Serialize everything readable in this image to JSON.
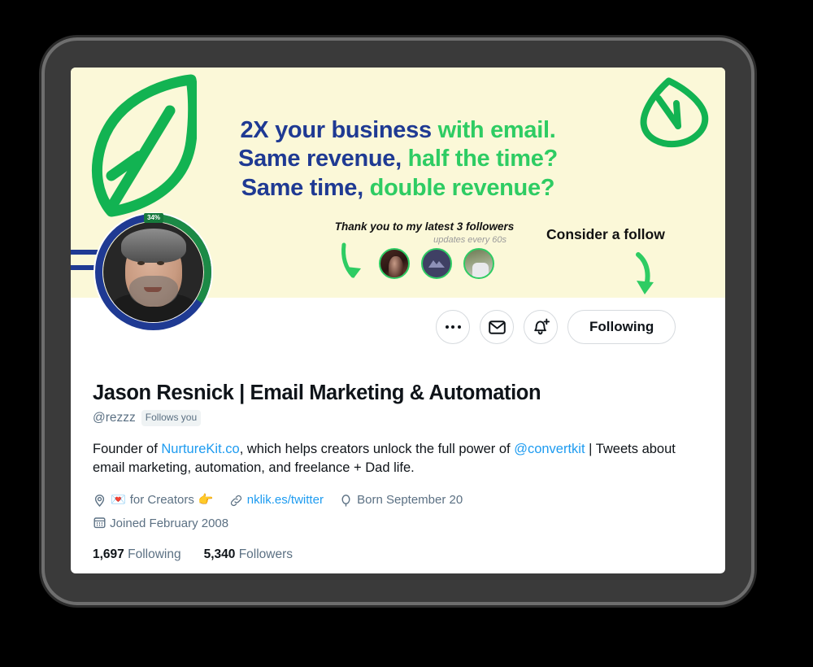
{
  "banner": {
    "headline_lines": [
      [
        {
          "t": "2X your business ",
          "c": "navy"
        },
        {
          "t": "with email.",
          "c": "green"
        }
      ],
      [
        {
          "t": "Same revenue, ",
          "c": "navy"
        },
        {
          "t": "half the time?",
          "c": "green"
        }
      ],
      [
        {
          "t": "Same time, ",
          "c": "navy"
        },
        {
          "t": "double revenue?",
          "c": "green"
        }
      ]
    ],
    "headline_line1_navy": "2X your business",
    "headline_line1_green": "with email.",
    "headline_line2_navy": "Same revenue,",
    "headline_line2_green": "half the time?",
    "headline_line3_navy": "Same time,",
    "headline_line3_green": "double revenue?",
    "thank_you_title": "Thank you to my latest 3 followers",
    "thank_you_subtitle": "updates every 60s",
    "consider_text": "Consider a follow",
    "colors": {
      "background": "#fbf8d8",
      "navy": "#1f3a93",
      "green": "#2ecc63"
    }
  },
  "avatar": {
    "progress_badge": "34%",
    "progress_percent": 34,
    "ring_color": "#1f3a93",
    "progress_color": "#1c8a46"
  },
  "actions": {
    "more_label": "more-options",
    "message_label": "message",
    "notify_label": "notify",
    "following_label": "Following"
  },
  "profile": {
    "display_name": "Jason Resnick | Email Marketing & Automation",
    "handle": "@rezzz",
    "follows_you": "Follows you",
    "bio_part1": "Founder of ",
    "bio_link1": "NurtureKit.co",
    "bio_part2": ", which helps creators unlock the full power of ",
    "bio_link2": "@convertkit",
    "bio_part3": " | Tweets about email marketing, automation, and freelance + Dad life.",
    "location_emoji1": "💌",
    "location_text": "for Creators",
    "location_emoji2": "👉",
    "website": "nklik.es/twitter",
    "birthday": "Born September 20",
    "joined": "Joined February 2008",
    "following_count": "1,697",
    "following_label": "Following",
    "followers_count": "5,340",
    "followers_label": "Followers"
  }
}
